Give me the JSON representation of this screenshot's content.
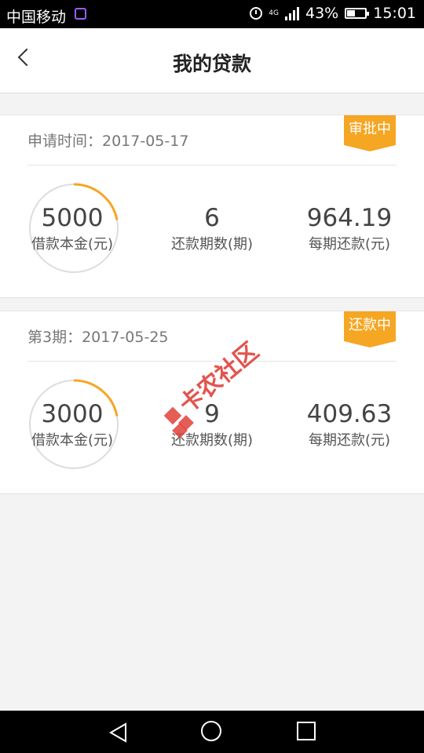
{
  "status_bar": {
    "carrier": "中国移动",
    "network": "4G",
    "battery": "43%",
    "time": "15:01"
  },
  "header": {
    "title": "我的贷款"
  },
  "loans": [
    {
      "date_label": "申请时间：2017-05-17",
      "status": "审批中",
      "principal": "5000",
      "principal_label": "借款本金(元)",
      "periods": "6",
      "periods_label": "还款期数(期)",
      "installment": "964.19",
      "installment_label": "每期还款(元)",
      "progress": 0.22
    },
    {
      "date_label": "第3期：2017-05-25",
      "status": "还款中",
      "principal": "3000",
      "principal_label": "借款本金(元)",
      "periods": "9",
      "periods_label": "还款期数(期)",
      "installment": "409.63",
      "installment_label": "每期还款(元)",
      "progress": 0.22
    }
  ],
  "watermark": {
    "text": "卡农社区"
  },
  "colors": {
    "accent": "#f5a623",
    "ring_track": "#dddddd",
    "watermark": "#e0413a"
  }
}
